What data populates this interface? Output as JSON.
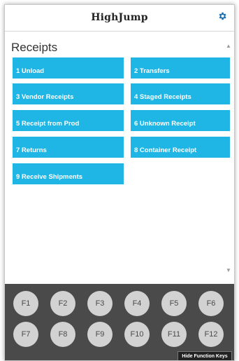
{
  "header": {
    "logo_text": "HighJump",
    "settings_icon": "gear-icon"
  },
  "page": {
    "title": "Receipts"
  },
  "menu": [
    {
      "label": "1 Unload"
    },
    {
      "label": "2 Transfers"
    },
    {
      "label": "3 Vendor Receipts"
    },
    {
      "label": "4 Staged Receipts"
    },
    {
      "label": "5 Receipt from Prod"
    },
    {
      "label": "6 Unknown Receipt"
    },
    {
      "label": "7 Returns"
    },
    {
      "label": "8 Container Receipt"
    },
    {
      "label": "9 Receive Shipments"
    }
  ],
  "function_keys": [
    "F1",
    "F2",
    "F3",
    "F4",
    "F5",
    "F6",
    "F7",
    "F8",
    "F9",
    "F10",
    "F11",
    "F12"
  ],
  "footer": {
    "hide_label": "Hide Function Keys"
  },
  "colors": {
    "accent": "#1fb6e5",
    "gear": "#1a6fb3",
    "function_panel": "#4a4a4a"
  }
}
